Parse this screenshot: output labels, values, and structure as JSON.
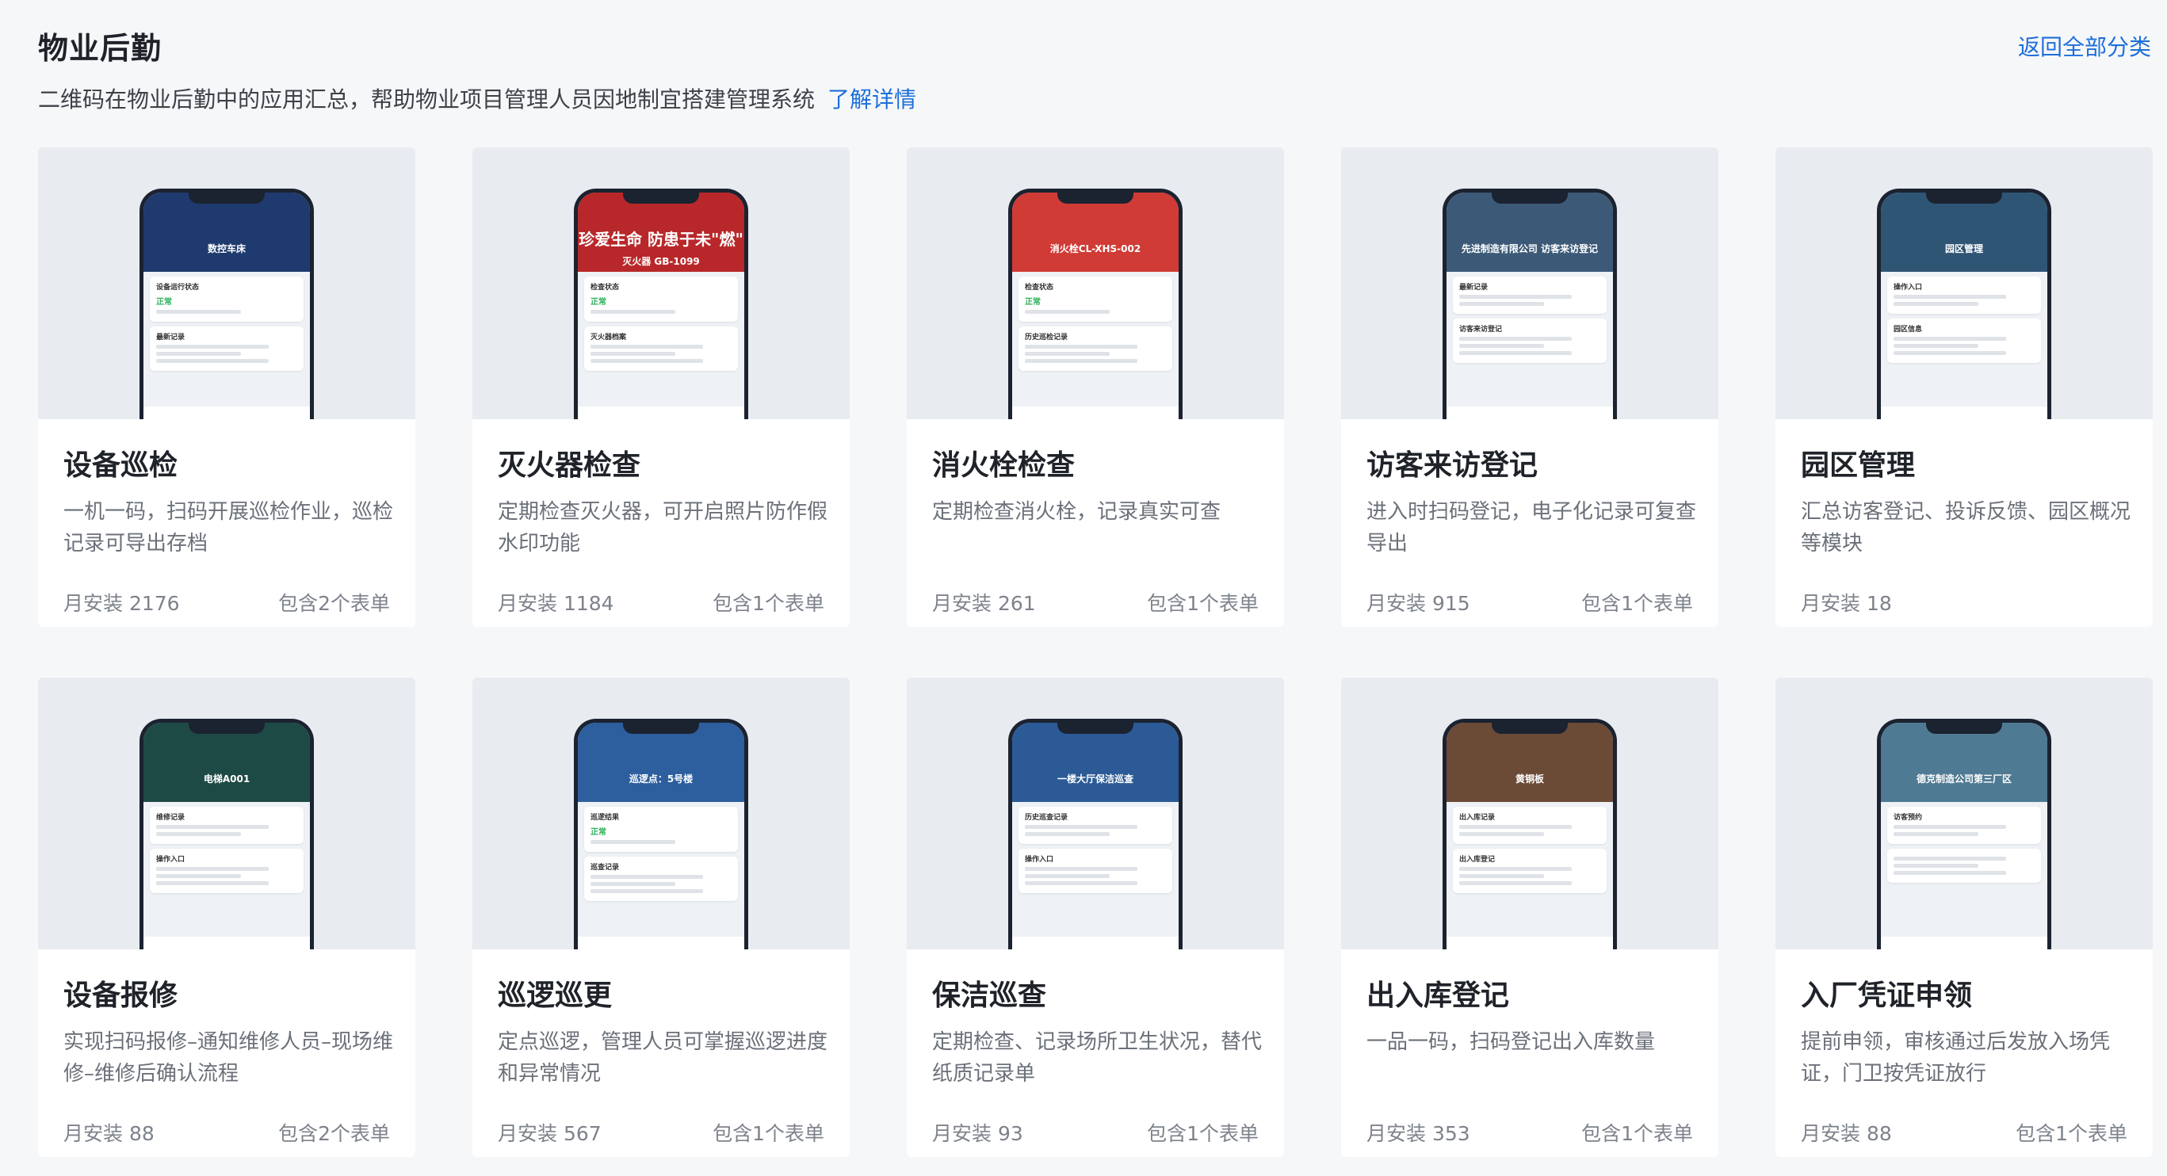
{
  "header": {
    "title": "物业后勤",
    "back_label": "返回全部分类",
    "subtitle": "二维码在物业后勤中的应用汇总，帮助物业项目管理人员因地制宜搭建管理系统",
    "more_label": "了解详情"
  },
  "colors": {
    "accent": "#1e6fd9",
    "ok_green": "#2fb25a"
  },
  "cards": [
    {
      "title": "设备巡检",
      "desc": "一机一码，扫码开展巡检作业，巡检记录可导出存档",
      "installs": "月安装 2176",
      "forms": "包含2个表单",
      "phone": {
        "header": "数控车床",
        "panel1": "设备运行状态",
        "status": "正常",
        "panel2": "最新记录",
        "bg": "#1f3a6e"
      }
    },
    {
      "title": "灭火器检查",
      "desc": "定期检查灭火器，可开启照片防作假水印功能",
      "installs": "月安装 1184",
      "forms": "包含1个表单",
      "phone": {
        "header": "珍爱生命 防患于未\"燃\"",
        "sub": "灭火器 GB-1099",
        "panel1": "检查状态",
        "status": "正常",
        "panel2": "灭火器档案",
        "bg": "#b8282a"
      }
    },
    {
      "title": "消火栓检查",
      "desc": "定期检查消火栓，记录真实可查",
      "installs": "月安装 261",
      "forms": "包含1个表单",
      "phone": {
        "header": "消火栓CL-XHS-002",
        "panel1": "检查状态",
        "status": "正常",
        "panel2": "历史巡检记录",
        "bg": "#d03b35"
      }
    },
    {
      "title": "访客来访登记",
      "desc": "进入时扫码登记，电子化记录可复查导出",
      "installs": "月安装 915",
      "forms": "包含1个表单",
      "phone": {
        "header": "先进制造有限公司 访客来访登记",
        "panel1": "最新记录",
        "status": "",
        "panel2": "访客来访登记",
        "bg": "#3c5a78"
      }
    },
    {
      "title": "园区管理",
      "desc": "汇总访客登记、投诉反馈、园区概况等模块",
      "installs": "月安装 18",
      "forms": "",
      "phone": {
        "header": "园区管理",
        "panel1": "操作入口",
        "status": "",
        "panel2": "园区信息",
        "bg": "#2f5575"
      }
    },
    {
      "title": "设备报修",
      "desc": "实现扫码报修–通知维修人员–现场维修–维修后确认流程",
      "installs": "月安装 88",
      "forms": "包含2个表单",
      "phone": {
        "header": "电梯A001",
        "panel1": "维修记录",
        "status": "",
        "panel2": "操作入口",
        "bg": "#1e4a45"
      }
    },
    {
      "title": "巡逻巡更",
      "desc": "定点巡逻，管理人员可掌握巡逻进度和异常情况",
      "installs": "月安装 567",
      "forms": "包含1个表单",
      "phone": {
        "header": "巡逻点：5号楼",
        "panel1": "巡逻结果",
        "status": "正常",
        "panel2": "巡查记录",
        "bg": "#2d5e9e"
      }
    },
    {
      "title": "保洁巡查",
      "desc": "定期检查、记录场所卫生状况，替代纸质记录单",
      "installs": "月安装 93",
      "forms": "包含1个表单",
      "phone": {
        "header": "一楼大厅保洁巡查",
        "panel1": "历史巡查记录",
        "status": "",
        "panel2": "操作入口",
        "bg": "#2b5a96"
      }
    },
    {
      "title": "出入库登记",
      "desc": "一品一码，扫码登记出入库数量",
      "installs": "月安装 353",
      "forms": "包含1个表单",
      "phone": {
        "header": "黄铜板",
        "panel1": "出入库记录",
        "status": "",
        "panel2": "出入库登记",
        "bg": "#6b4a36"
      }
    },
    {
      "title": "入厂凭证申领",
      "desc": "提前申领，审核通过后发放入场凭证，门卫按凭证放行",
      "installs": "月安装 88",
      "forms": "包含1个表单",
      "phone": {
        "header": "德克制造公司第三厂区",
        "panel1": "访客预约",
        "status": "",
        "panel2": "",
        "bg": "#4f7a93"
      }
    }
  ]
}
